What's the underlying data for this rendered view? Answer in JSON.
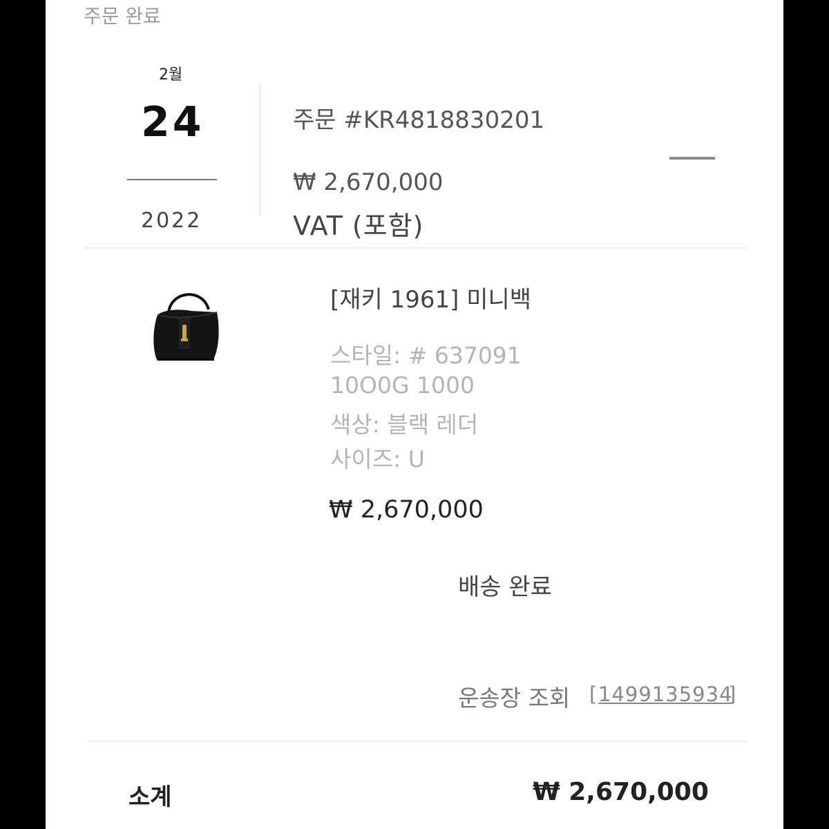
{
  "header": {
    "status": "주문 완료"
  },
  "order": {
    "month": "2월",
    "day": "24",
    "year": "2022",
    "number": "주문 #KR4818830201",
    "total": "₩ 2,670,000",
    "vat_note": "VAT (포함)"
  },
  "item": {
    "image_icon": "handbag-image",
    "name": "[재키 1961] 미니백",
    "style": "스타일: # 637091",
    "style_code": "10O0G 1000",
    "color": "색상: 블랙 레더",
    "size": "사이즈: U",
    "price": "₩ 2,670,000"
  },
  "shipping": {
    "status": "배송 완료",
    "tracking_label": "운송장 조회",
    "tracking_open": "[",
    "tracking_number": "1499135934",
    "tracking_close": "]"
  },
  "summary": {
    "subtotal_label": "소계",
    "subtotal_value": "₩ 2,670,000"
  }
}
